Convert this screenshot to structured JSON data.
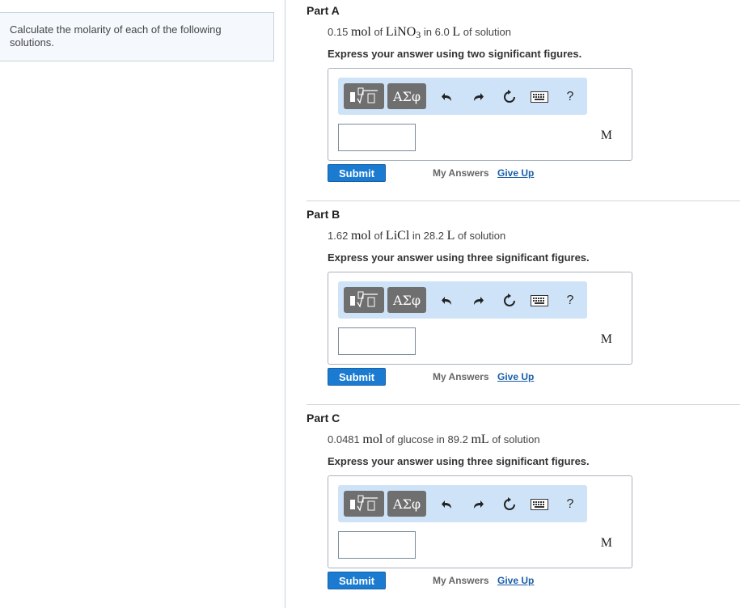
{
  "intro": {
    "text": "Calculate the molarity of each of the following solutions."
  },
  "parts": [
    {
      "title": "Part A",
      "question": {
        "amount": "0.15",
        "unit1": "mol",
        "of1": "of",
        "substance": "LiNO",
        "subscript": "3",
        "in": "in",
        "volume": "6.0",
        "unit2": "L",
        "of2": "of solution"
      },
      "instruction": "Express your answer using two significant figures.",
      "answer_unit": "M",
      "submit_label": "Submit",
      "my_answers_label": "My Answers",
      "give_up_label": "Give Up"
    },
    {
      "title": "Part B",
      "question": {
        "amount": "1.62",
        "unit1": "mol",
        "of1": "of",
        "substance": "LiCl",
        "subscript": "",
        "in": "in",
        "volume": "28.2",
        "unit2": "L",
        "of2": "of solution"
      },
      "instruction": "Express your answer using three significant figures.",
      "answer_unit": "M",
      "submit_label": "Submit",
      "my_answers_label": "My Answers",
      "give_up_label": "Give Up"
    },
    {
      "title": "Part C",
      "question": {
        "amount": "0.0481",
        "unit1": "mol",
        "of1": "of glucose",
        "substance": "",
        "subscript": "",
        "in": "in",
        "volume": "89.2",
        "unit2": "mL",
        "of2": "of solution"
      },
      "instruction": "Express your answer using three significant figures.",
      "answer_unit": "M",
      "submit_label": "Submit",
      "my_answers_label": "My Answers",
      "give_up_label": "Give Up"
    }
  ],
  "toolbar": {
    "symbols_label": "ΑΣφ",
    "help_label": "?",
    "icons": [
      "templates-icon",
      "undo-icon",
      "redo-icon",
      "reset-icon",
      "keyboard-icon",
      "help-icon"
    ]
  },
  "colors": {
    "submit": "#1b7bd1",
    "toolbar_bg": "#cfe3f8",
    "link": "#1a5ea8"
  }
}
